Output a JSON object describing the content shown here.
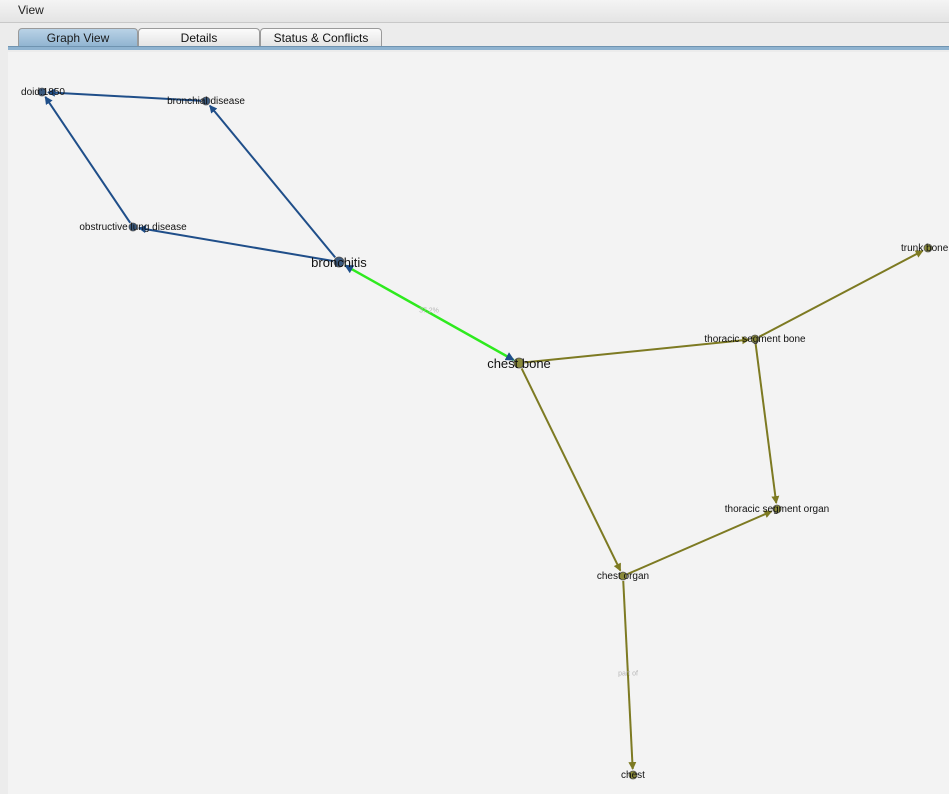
{
  "menu": {
    "view_label": "View"
  },
  "tabs": [
    {
      "label": "Graph View",
      "active": true
    },
    {
      "label": "Details",
      "active": false
    },
    {
      "label": "Status & Conflicts",
      "active": false
    }
  ],
  "colors": {
    "blue_edge": "#1f4e89",
    "olive_edge": "#7d7a22",
    "highlight_edge": "#2eea1e",
    "node_blue": "#3b5a7f",
    "node_olive": "#8a8a3a"
  },
  "graph": {
    "nodes": [
      {
        "id": "doid1850",
        "label": "doid:1850",
        "group": "blue"
      },
      {
        "id": "bronchial_disease",
        "label": "bronchial disease",
        "group": "blue"
      },
      {
        "id": "obstructive_lung_disease",
        "label": "obstructive lung disease",
        "group": "blue"
      },
      {
        "id": "bronchitis",
        "label": "bronchitis",
        "group": "blue",
        "emphasis": true
      },
      {
        "id": "chest_bone",
        "label": "chest bone",
        "group": "olive",
        "emphasis": true
      },
      {
        "id": "thoracic_segment_bone",
        "label": "thoracic segment bone",
        "group": "olive"
      },
      {
        "id": "trunk_bone",
        "label": "trunk bone",
        "group": "olive"
      },
      {
        "id": "thoracic_segment_organ",
        "label": "thoracic segment organ",
        "group": "olive"
      },
      {
        "id": "chest_organ",
        "label": "chest organ",
        "group": "olive"
      },
      {
        "id": "chest",
        "label": "chest",
        "group": "olive"
      }
    ],
    "edges": [
      {
        "from": "bronchial_disease",
        "to": "doid1850",
        "color": "blue"
      },
      {
        "from": "obstructive_lung_disease",
        "to": "doid1850",
        "color": "blue"
      },
      {
        "from": "bronchitis",
        "to": "bronchial_disease",
        "color": "blue"
      },
      {
        "from": "bronchitis",
        "to": "obstructive_lung_disease",
        "color": "blue"
      },
      {
        "from": "chest_bone",
        "to": "bronchitis",
        "color": "highlight",
        "bidirectional": true,
        "label": "37.2%"
      },
      {
        "from": "chest_bone",
        "to": "thoracic_segment_bone",
        "color": "olive"
      },
      {
        "from": "thoracic_segment_bone",
        "to": "trunk_bone",
        "color": "olive"
      },
      {
        "from": "thoracic_segment_bone",
        "to": "thoracic_segment_organ",
        "color": "olive"
      },
      {
        "from": "chest_bone",
        "to": "chest_organ",
        "color": "olive"
      },
      {
        "from": "chest_organ",
        "to": "thoracic_segment_organ",
        "color": "olive"
      },
      {
        "from": "chest_organ",
        "to": "chest",
        "color": "olive",
        "label": "part of"
      }
    ]
  }
}
